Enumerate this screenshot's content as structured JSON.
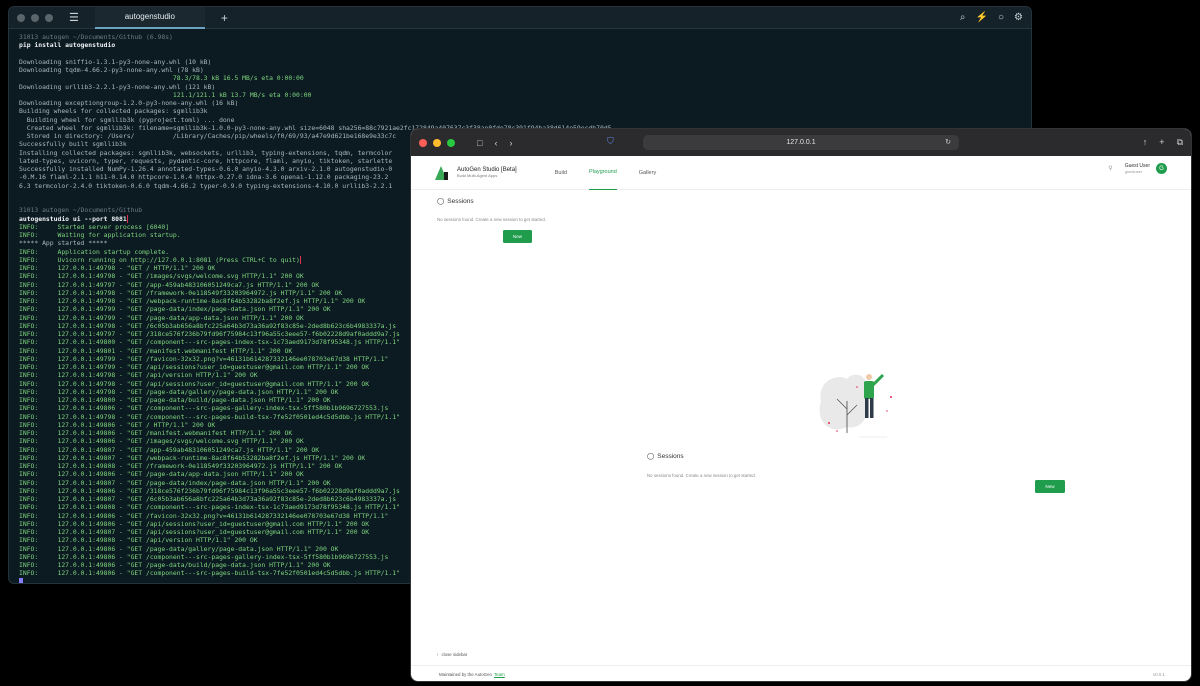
{
  "terminal": {
    "logo": "☰",
    "tab_title": "autogenstudio",
    "plus": "+",
    "toolbar_icons": [
      "⌕",
      "⚡",
      "○",
      "⚙"
    ],
    "lines": [
      {
        "t": "31013 autogen ~/Documents/Github (6.98s)",
        "c": "c-dim"
      },
      {
        "t": "pip install autogenstudio",
        "c": "c-cmd"
      },
      {
        "t": "",
        "c": ""
      },
      {
        "t": "Downloading sniffio-1.3.1-py3-none-any.whl (10 kB)",
        "c": ""
      },
      {
        "t": "Downloading tqdm-4.66.2-py3-none-any.whl (78 kB)",
        "c": ""
      },
      {
        "t": "                                        78.3/78.3 kB 16.5 MB/s eta 0:00:00",
        "c": "c-green"
      },
      {
        "t": "Downloading urllib3-2.2.1-py3-none-any.whl (121 kB)",
        "c": ""
      },
      {
        "t": "                                        121.1/121.1 kB 13.7 MB/s eta 0:00:00",
        "c": "c-green"
      },
      {
        "t": "Downloading exceptiongroup-1.2.0-py3-none-any.whl (16 kB)",
        "c": ""
      },
      {
        "t": "Building wheels for collected packages: sgmllib3k",
        "c": ""
      },
      {
        "t": "  Building wheel for sgmllib3k (pyproject.toml) ... done",
        "c": ""
      },
      {
        "t": "  Created wheel for sgmllib3k: filename=sgmllib3k-1.0.0-py3-none-any.whl size=6048 sha256=88c7921ae2fc172849a407637c3f38ae0fde78c391f94ba38d614e59ecdb70d5",
        "c": ""
      },
      {
        "t": "  Stored in directory: /Users/          /Library/Caches/pip/wheels/f0/69/93/a47e9d621be168e9e33c7c",
        "c": ""
      },
      {
        "t": "Successfully built sgmllib3k",
        "c": ""
      },
      {
        "t": "Installing collected packages: sgmllib3k, websockets, urllib3, typing-extensions, tqdm, termcolor",
        "c": ""
      },
      {
        "t": "lated-types, uvicorn, typer, requests, pydantic-core, httpcore, flaml, anyio, tiktoken, starlette",
        "c": ""
      },
      {
        "t": "Successfully installed NumPy-1.26.4 annotated-types-0.6.0 anyio-4.3.0 arxiv-2.1.0 autogenstudio-0",
        "c": ""
      },
      {
        "t": "-0.M.16 flaml-2.1.1 h11-0.14.0 httpcore-1.0.4 httpx-0.27.0 idna-3.6 openai-1.12.0 packaging-23.2",
        "c": ""
      },
      {
        "t": "6.3 termcolor-2.4.0 tiktoken-0.6.0 tqdm-4.66.2 typer-0.9.0 typing-extensions-4.10.0 urllib3-2.2.1",
        "c": ""
      },
      {
        "t": "",
        "c": ""
      },
      {
        "t": "",
        "c": ""
      },
      {
        "t": "31013 autogen ~/Documents/Github",
        "c": "c-dim"
      },
      {
        "t": "autogenstudio ui --port 8081",
        "c": "c-cmd",
        "box": true
      },
      {
        "t": "INFO:     Started server process [6040]",
        "c": "c-info"
      },
      {
        "t": "INFO:     Waiting for application startup.",
        "c": "c-info"
      },
      {
        "t": "***** App started *****",
        "c": ""
      },
      {
        "t": "INFO:     Application startup complete.",
        "c": "c-info"
      },
      {
        "t": "INFO:     Uvicorn running on http://127.0.0.1:8081 (Press CTRL+C to quit)",
        "c": "c-info",
        "box2": true
      },
      {
        "t": "INFO:     127.0.0.1:49798 - \"GET / HTTP/1.1\" 200 OK",
        "c": "c-info"
      },
      {
        "t": "INFO:     127.0.0.1:49798 - \"GET /images/svgs/welcome.svg HTTP/1.1\" 200 OK",
        "c": "c-info"
      },
      {
        "t": "INFO:     127.0.0.1:49797 - \"GET /app-459ab483106051249ca7.js HTTP/1.1\" 200 OK",
        "c": "c-info"
      },
      {
        "t": "INFO:     127.0.0.1:49798 - \"GET /framework-0e118549f33203964972.js HTTP/1.1\" 200 OK",
        "c": "c-info"
      },
      {
        "t": "INFO:     127.0.0.1:49798 - \"GET /webpack-runtime-8ac8f64b53282ba8f2ef.js HTTP/1.1\" 200 OK",
        "c": "c-info"
      },
      {
        "t": "INFO:     127.0.0.1:49799 - \"GET /page-data/index/page-data.json HTTP/1.1\" 200 OK",
        "c": "c-info"
      },
      {
        "t": "INFO:     127.0.0.1:49799 - \"GET /page-data/app-data.json HTTP/1.1\" 200 OK",
        "c": "c-info"
      },
      {
        "t": "INFO:     127.0.0.1:49798 - \"GET /6c05b3ab656a8bfc225a64b3d73a36a92f83c85e-2ded8b623c6b4983337a.js",
        "c": "c-info"
      },
      {
        "t": "INFO:     127.0.0.1:49797 - \"GET /318ce576f236b79fd96f75984c13f96a55c3eee57-f6b02228d9af0addd9a7.js",
        "c": "c-info"
      },
      {
        "t": "INFO:     127.0.0.1:49800 - \"GET /component---src-pages-index-tsx-1c73aed9173d78f95348.js HTTP/1.1\"",
        "c": "c-info"
      },
      {
        "t": "INFO:     127.0.0.1:49801 - \"GET /manifest.webmanifest HTTP/1.1\" 200 OK",
        "c": "c-info"
      },
      {
        "t": "INFO:     127.0.0.1:49799 - \"GET /favicon-32x32.png?v=46131b614287332146ee078703e67d38 HTTP/1.1\"",
        "c": "c-info"
      },
      {
        "t": "INFO:     127.0.0.1:49799 - \"GET /api/sessions?user_id=guestuser@gmail.com HTTP/1.1\" 200 OK",
        "c": "c-info"
      },
      {
        "t": "INFO:     127.0.0.1:49798 - \"GET /api/version HTTP/1.1\" 200 OK",
        "c": "c-info"
      },
      {
        "t": "INFO:     127.0.0.1:49798 - \"GET /api/sessions?user_id=guestuser@gmail.com HTTP/1.1\" 200 OK",
        "c": "c-info"
      },
      {
        "t": "INFO:     127.0.0.1:49798 - \"GET /page-data/gallery/page-data.json HTTP/1.1\" 200 OK",
        "c": "c-info"
      },
      {
        "t": "INFO:     127.0.0.1:49800 - \"GET /page-data/build/page-data.json HTTP/1.1\" 200 OK",
        "c": "c-info"
      },
      {
        "t": "INFO:     127.0.0.1:49806 - \"GET /component---src-pages-gallery-index-tsx-5ff580b1b9696727553.js",
        "c": "c-info"
      },
      {
        "t": "INFO:     127.0.0.1:49798 - \"GET /component---src-pages-build-tsx-7fe52f0501ed4c5d5dbb.js HTTP/1.1\"",
        "c": "c-info"
      },
      {
        "t": "INFO:     127.0.0.1:49806 - \"GET / HTTP/1.1\" 200 OK",
        "c": "c-info"
      },
      {
        "t": "INFO:     127.0.0.1:49806 - \"GET /manifest.webmanifest HTTP/1.1\" 200 OK",
        "c": "c-info"
      },
      {
        "t": "INFO:     127.0.0.1:49806 - \"GET /images/svgs/welcome.svg HTTP/1.1\" 200 OK",
        "c": "c-info"
      },
      {
        "t": "INFO:     127.0.0.1:49807 - \"GET /app-459ab483106051249ca7.js HTTP/1.1\" 200 OK",
        "c": "c-info"
      },
      {
        "t": "INFO:     127.0.0.1:49807 - \"GET /webpack-runtime-8ac8f64b53282ba8f2ef.js HTTP/1.1\" 200 OK",
        "c": "c-info"
      },
      {
        "t": "INFO:     127.0.0.1:49808 - \"GET /framework-0e118549f33203964972.js HTTP/1.1\" 200 OK",
        "c": "c-info"
      },
      {
        "t": "INFO:     127.0.0.1:49806 - \"GET /page-data/app-data.json HTTP/1.1\" 200 OK",
        "c": "c-info"
      },
      {
        "t": "INFO:     127.0.0.1:49807 - \"GET /page-data/index/page-data.json HTTP/1.1\" 200 OK",
        "c": "c-info"
      },
      {
        "t": "INFO:     127.0.0.1:49806 - \"GET /318ce576f236b79fd96f75984c13f96a55c3eee57-f6b02228d9af0addd9a7.js",
        "c": "c-info"
      },
      {
        "t": "INFO:     127.0.0.1:49807 - \"GET /6c05b3ab656a8bfc225a64b3d73a36a92f83c85e-2ded8b623c6b4983337a.js",
        "c": "c-info"
      },
      {
        "t": "INFO:     127.0.0.1:49808 - \"GET /component---src-pages-index-tsx-1c73aed9173d78f95348.js HTTP/1.1\"",
        "c": "c-info"
      },
      {
        "t": "INFO:     127.0.0.1:49806 - \"GET /favicon-32x32.png?v=46131b614287332146ee078703e67d38 HTTP/1.1\"",
        "c": "c-info"
      },
      {
        "t": "INFO:     127.0.0.1:49806 - \"GET /api/sessions?user_id=guestuser@gmail.com HTTP/1.1\" 200 OK",
        "c": "c-info"
      },
      {
        "t": "INFO:     127.0.0.1:49807 - \"GET /api/sessions?user_id=guestuser@gmail.com HTTP/1.1\" 200 OK",
        "c": "c-info"
      },
      {
        "t": "INFO:     127.0.0.1:49808 - \"GET /api/version HTTP/1.1\" 200 OK",
        "c": "c-info"
      },
      {
        "t": "INFO:     127.0.0.1:49806 - \"GET /page-data/gallery/page-data.json HTTP/1.1\" 200 OK",
        "c": "c-info"
      },
      {
        "t": "INFO:     127.0.0.1:49806 - \"GET /component---src-pages-gallery-index-tsx-5ff580b1b9696727553.js",
        "c": "c-info"
      },
      {
        "t": "INFO:     127.0.0.1:49806 - \"GET /page-data/build/page-data.json HTTP/1.1\" 200 OK",
        "c": "c-info"
      },
      {
        "t": "INFO:     127.0.0.1:49806 - \"GET /component---src-pages-build-tsx-7fe52f0501ed4c5d5dbb.js HTTP/1.1\"",
        "c": "c-info"
      }
    ]
  },
  "browser": {
    "url": "127.0.0.1",
    "nav_icons": [
      "□",
      "‹",
      "›"
    ],
    "right_icons": [
      "↑",
      "+",
      "⧉"
    ],
    "translate_icon": "↻",
    "shield_icon": "⛉"
  },
  "app": {
    "brand_title": "AutoGen Studio [Beta]",
    "brand_sub": "Build Multi-Agent Apps",
    "nav": [
      {
        "label": "Build",
        "active": false
      },
      {
        "label": "Playground",
        "active": true
      },
      {
        "label": "Gallery",
        "active": false
      }
    ],
    "user_name": "Guest User",
    "user_email": "guestuser",
    "avatar_letter": "G",
    "sidebar": {
      "title": "Sessions",
      "desc": "No sessions found. Create a new session to get started.",
      "new_label": "New"
    },
    "main": {
      "title": "Sessions",
      "desc": "No sessions found. Create a new session to get started.",
      "new_label": "New"
    },
    "close_sidebar": "close sidebar",
    "footer_text": "Maintained by the AutoGen",
    "footer_link": "Team",
    "version": "v0.0.1"
  }
}
